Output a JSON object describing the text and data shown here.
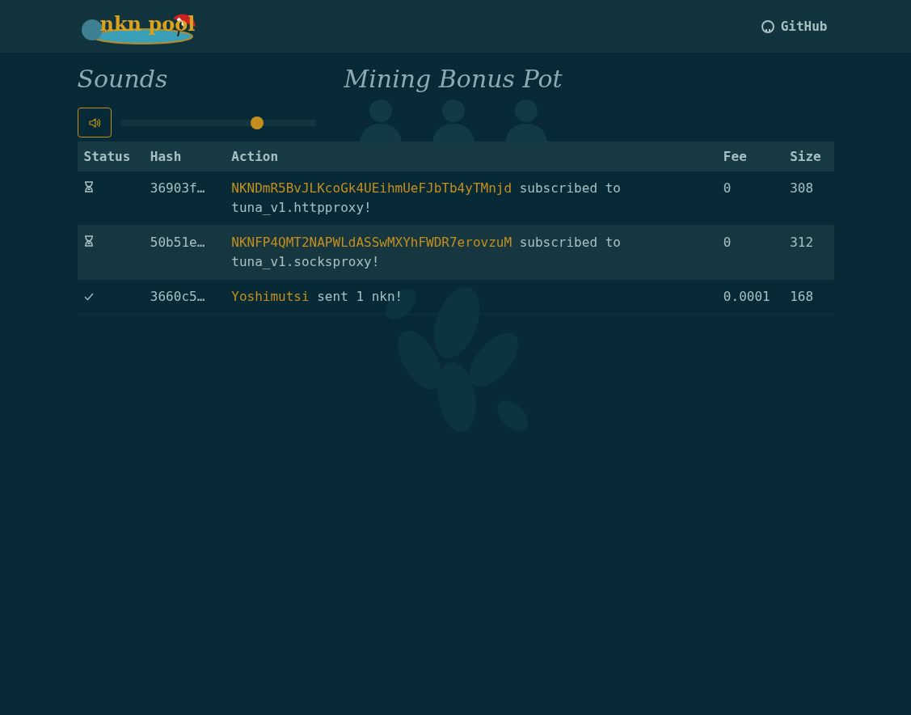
{
  "header": {
    "logo_text": "nkn pool",
    "github_link": "GitHub"
  },
  "sounds": {
    "title": "Sounds",
    "volume": {
      "level": 0.7
    }
  },
  "bonus": {
    "title": "Mining Bonus Pot"
  },
  "table": {
    "columns": [
      "Status",
      "Hash",
      "Action",
      "Fee",
      "Size"
    ],
    "rows": [
      {
        "kind": "pending",
        "hash": "36903f…",
        "actor": "NKNDmR5BvJLKcoGk4UEihmUeFJbTb4yTMnjd",
        "action": "subscribed to tuna_v1.httpproxy!",
        "fee": "0",
        "size": "308"
      },
      {
        "kind": "pending",
        "hash": "50b51e…",
        "actor": "NKNFP4QMT2NAPWLdASSwMXYhFWDR7erovzuM",
        "action": "subscribed to tuna_v1.socksproxy!",
        "fee": "0",
        "size": "312"
      },
      {
        "kind": "confirmed",
        "hash": "3660c5…",
        "actor": "Yoshimutsi",
        "action": "sent 1 nkn!",
        "fee": "0.0001",
        "size": "168"
      }
    ]
  }
}
